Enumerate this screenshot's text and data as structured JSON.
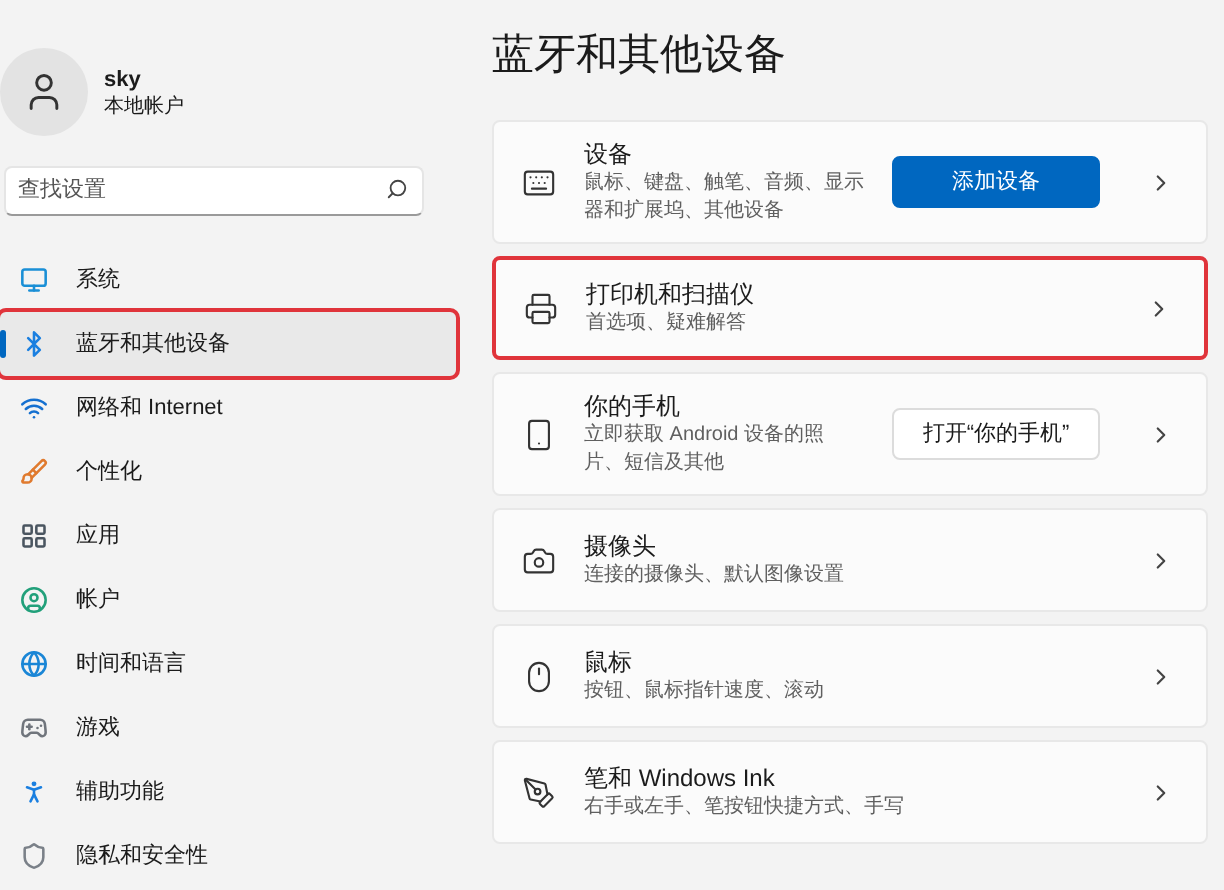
{
  "user": {
    "name": "sky",
    "account": "本地帐户"
  },
  "search": {
    "placeholder": "查找设置"
  },
  "nav": [
    {
      "label": "系统",
      "selected": false,
      "highlighted": false
    },
    {
      "label": "蓝牙和其他设备",
      "selected": true,
      "highlighted": true
    },
    {
      "label": "网络和 Internet",
      "selected": false,
      "highlighted": false
    },
    {
      "label": "个性化",
      "selected": false,
      "highlighted": false
    },
    {
      "label": "应用",
      "selected": false,
      "highlighted": false
    },
    {
      "label": "帐户",
      "selected": false,
      "highlighted": false
    },
    {
      "label": "时间和语言",
      "selected": false,
      "highlighted": false
    },
    {
      "label": "游戏",
      "selected": false,
      "highlighted": false
    },
    {
      "label": "辅助功能",
      "selected": false,
      "highlighted": false
    },
    {
      "label": "隐私和安全性",
      "selected": false,
      "highlighted": false
    }
  ],
  "page_title": "蓝牙和其他设备",
  "cards": [
    {
      "title": "设备",
      "description": "鼠标、键盘、触笔、音频、显示器和扩展坞、其他设备",
      "highlighted": false,
      "action": {
        "kind": "primary",
        "label": "添加设备"
      }
    },
    {
      "title": "打印机和扫描仪",
      "description": "首选项、疑难解答",
      "highlighted": true
    },
    {
      "title": "你的手机",
      "description": "立即获取 Android 设备的照片、短信及其他",
      "highlighted": false,
      "action": {
        "kind": "secondary",
        "label": "打开“你的手机”"
      }
    },
    {
      "title": "摄像头",
      "description": "连接的摄像头、默认图像设置",
      "highlighted": false
    },
    {
      "title": "鼠标",
      "description": "按钮、鼠标指针速度、滚动",
      "highlighted": false
    },
    {
      "title": "笔和 Windows Ink",
      "description": "右手或左手、笔按钮快捷方式、手写",
      "highlighted": false
    }
  ]
}
